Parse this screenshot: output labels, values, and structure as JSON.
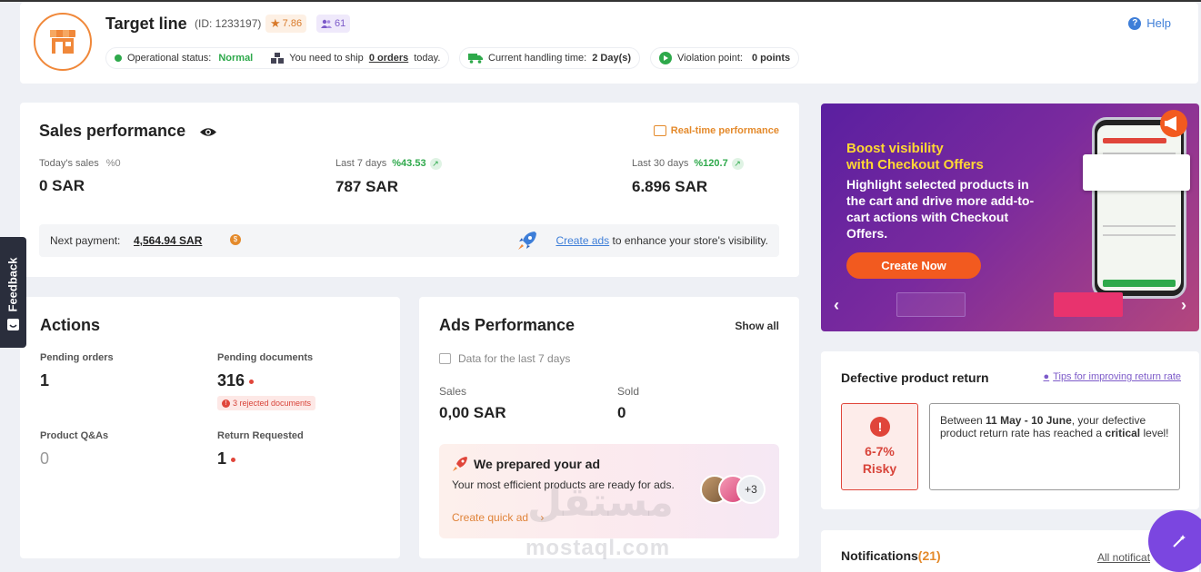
{
  "store": {
    "name": "Target line",
    "id_text": "(ID: 1233197)",
    "rating": "7.86",
    "followers": "61",
    "help_label": "Help",
    "status_label": "Operational status:",
    "status_value": "Normal",
    "ship_prefix": "You need to ship",
    "ship_orders": "0 orders",
    "ship_suffix": "today.",
    "handling_label": "Current handling time:",
    "handling_value": "2 Day(s)",
    "violation_label": "Violation point:",
    "violation_value": "0 points"
  },
  "sales": {
    "title": "Sales performance",
    "realtime_label": "Real-time performance",
    "today_label": "Today's sales",
    "today_pct": "%0",
    "today_value": "0 SAR",
    "week_label": "Last 7 days",
    "week_pct": "%43.53",
    "week_value": "787 SAR",
    "month_label": "Last 30 days",
    "month_pct": "%120.7",
    "month_value": "6.896 SAR",
    "next_payment_label": "Next payment:",
    "next_payment_value": "4,564.94 SAR",
    "create_ads_link": "Create ads",
    "create_ads_suffix": "to enhance your store's visibility."
  },
  "actions": {
    "title": "Actions",
    "pending_orders_label": "Pending orders",
    "pending_orders_value": "1",
    "pending_docs_label": "Pending documents",
    "pending_docs_value": "316",
    "rejected_docs": "3 rejected documents",
    "qa_label": "Product Q&As",
    "qa_value": "0",
    "return_label": "Return Requested",
    "return_value": "1"
  },
  "ads": {
    "title": "Ads Performance",
    "show_all": "Show all",
    "data_note": "Data for the last 7 days",
    "sales_label": "Sales",
    "sales_value": "0,00 SAR",
    "sold_label": "Sold",
    "sold_value": "0",
    "promo_title": "We prepared your ad",
    "promo_desc": "Your most efficient products are ready for ads.",
    "promo_cta": "Create quick ad",
    "promo_more": "+3"
  },
  "banner": {
    "headline_1": "Boost visibility",
    "headline_2": "with Checkout Offers",
    "body": "Highlight selected products in the cart and drive more add-to-cart actions with Checkout Offers.",
    "cta": "Create Now"
  },
  "defect": {
    "title": "Defective product return",
    "tips_link": "Tips for improving return rate",
    "risk_pct": "6-7%",
    "risk_level": "Risky",
    "msg_prefix": "Between",
    "msg_dates": "11 May - 10 June",
    "msg_middle": ", your defective product return rate has reached a",
    "msg_level": "critical",
    "msg_suffix": "level!"
  },
  "notifications": {
    "title": "Notifications",
    "count": "(21)",
    "all_link": "All notificat"
  },
  "feedback_label": "Feedback",
  "watermark": {
    "arabic": "مستقل",
    "latin": "mostaql.com"
  },
  "colors": {
    "accent_orange": "#f0883a",
    "positive_green": "#2ea94b",
    "danger_red": "#e0453a",
    "link_blue": "#3e7ed8",
    "purple": "#7b46e0"
  }
}
